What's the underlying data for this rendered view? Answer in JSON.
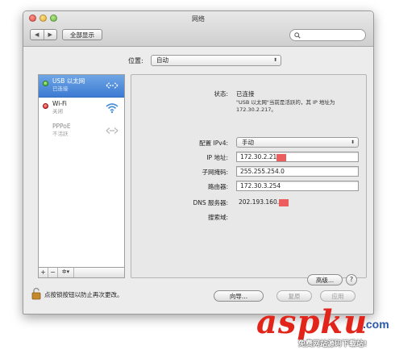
{
  "window": {
    "title": "网络",
    "nav_back": "◀",
    "nav_forward": "▶",
    "show_all": "全部显示",
    "search_placeholder": ""
  },
  "location": {
    "label": "位置:",
    "value": "自动"
  },
  "services": [
    {
      "name": "USB 以太网",
      "status": "已连接",
      "dot": "green",
      "icon": "ethernet-arrows-icon",
      "active": true
    },
    {
      "name": "Wi-Fi",
      "status": "关闭",
      "dot": "red",
      "icon": "wifi-icon",
      "active": false
    },
    {
      "name": "PPPoE",
      "status": "不活跃",
      "dot": "none",
      "icon": "ethernet-arrows-icon",
      "active": false
    }
  ],
  "sidebar_toolbar": {
    "add": "+",
    "remove": "−",
    "gear": "✲▾"
  },
  "detail": {
    "status_label": "状态:",
    "status_value": "已连接",
    "status_note": "\"USB 以太网\"当前是活跃的，其 IP 地址为 172.30.2.217。",
    "configure_label": "配置 IPv4:",
    "configure_value": "手动",
    "ip_label": "IP 地址:",
    "ip_value": "172.30.2.21",
    "subnet_label": "子网掩码:",
    "subnet_value": "255.255.254.0",
    "router_label": "路由器:",
    "router_value": "172.30.3.254",
    "dns_label": "DNS 服务器:",
    "dns_value": "202.193.160.",
    "search_domains_label": "搜索域:",
    "advanced_button": "高级...",
    "help_button": "?"
  },
  "footer": {
    "lock_text": "点按锁按钮以防止再次更改。",
    "assist_button": "向导...",
    "revert_button": "复原",
    "apply_button": "应用"
  },
  "watermark": {
    "brand": "aspku",
    "tld": ".com",
    "tagline": "免费网站源码下载站!"
  },
  "colors": {
    "selection": "#3d7bd3",
    "redaction": "#ec5d5d",
    "watermark_red": "#e1251b",
    "watermark_blue": "#2b5aa8"
  }
}
